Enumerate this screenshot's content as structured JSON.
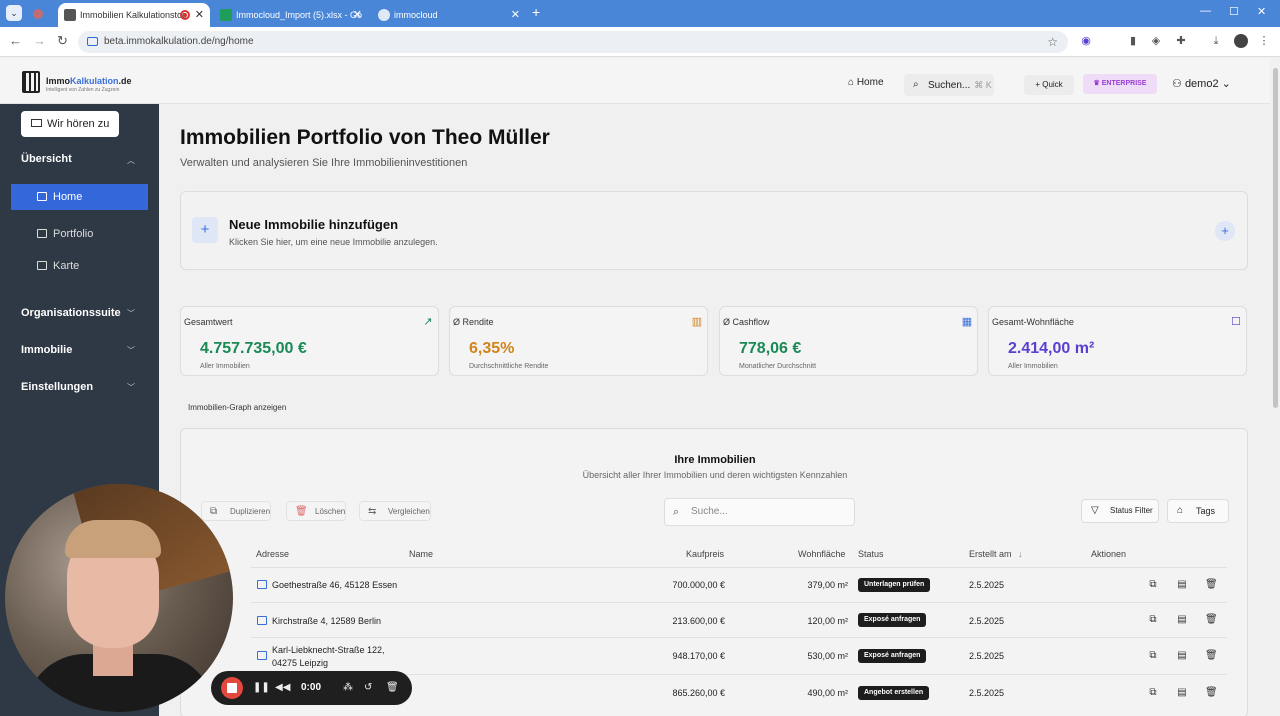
{
  "browser": {
    "tabs": [
      {
        "title": "Immobilien Kalkulationstoo",
        "active": true
      },
      {
        "title": "Immocloud_Import (5).xlsx - Go",
        "active": false
      },
      {
        "title": "immocloud",
        "active": false
      }
    ],
    "url": "beta.immokalkulation.de/ng/home"
  },
  "header": {
    "logo_prefix": "Immo",
    "logo_accent": "Kalkulation",
    "logo_suffix": ".de",
    "logo_tagline": "Intelligent von Zahlen zu Zugzein",
    "home": "Home",
    "search": "Suchen...",
    "search_kbd": "⌘ K",
    "quick": "Quick",
    "plan": "ENTERPRISE",
    "user": "demo2"
  },
  "sidebar": {
    "feedback": "Wir hören zu",
    "sections": {
      "uebersicht": "Übersicht",
      "organisationssuite": "Organisationssuite",
      "immobilie": "Immobilie",
      "einstellungen": "Einstellungen"
    },
    "items": {
      "home": "Home",
      "portfolio": "Portfolio",
      "karte": "Karte"
    }
  },
  "main": {
    "title": "Immobilien Portfolio von Theo Müller",
    "subtitle": "Verwalten und analysieren Sie Ihre Immobilieninvestitionen",
    "add_title": "Neue Immobilie hinzufügen",
    "add_sub": "Klicken Sie hier, um eine neue Immobilie anzulegen.",
    "graph_link": "Immobilien-Graph anzeigen",
    "stats": [
      {
        "label": "Gesamtwert",
        "value": "4.757.735,00 €",
        "sub": "Aller Immobilien",
        "color": "#1a8a55"
      },
      {
        "label": "Ø Rendite",
        "value": "6,35%",
        "sub": "Durchschnittliche Rendite",
        "color": "#d1841b"
      },
      {
        "label": "Ø Cashflow",
        "value": "778,06 €",
        "sub": "Monatlicher Durchschnitt",
        "color": "#1a8a55"
      },
      {
        "label": "Gesamt-Wohnfläche",
        "value": "2.414,00 m²",
        "sub": "Aller Immobilien",
        "color": "#5a3fd0"
      }
    ]
  },
  "table": {
    "title": "Ihre Immobilien",
    "subtitle": "Übersicht aller Ihrer Immobilien und deren wichtigsten Kennzahlen",
    "duplicate": "Duplizieren",
    "delete": "Löschen",
    "compare": "Vergleichen",
    "search_placeholder": "Suche...",
    "status_filter": "Status Filter",
    "tags": "Tags",
    "columns": {
      "address": "Adresse",
      "name": "Name",
      "price": "Kaufpreis",
      "area": "Wohnfläche",
      "status": "Status",
      "created": "Erstellt am",
      "created_sort": "↓",
      "actions": "Aktionen"
    },
    "rows": [
      {
        "address1": "Goethestraße 46, 45128 Essen",
        "address2": "",
        "price": "700.000,00 €",
        "area": "379,00 m²",
        "status": "Unterlagen prüfen",
        "created": "2.5.2025"
      },
      {
        "address1": "Kirchstraße 4, 12589 Berlin",
        "address2": "",
        "price": "213.600,00 €",
        "area": "120,00 m²",
        "status": "Exposé anfragen",
        "created": "2.5.2025"
      },
      {
        "address1": "Karl-Liebknecht-Straße 122,",
        "address2": "04275 Leipzig",
        "price": "948.170,00 €",
        "area": "530,00 m²",
        "status": "Exposé anfragen",
        "created": "2.5.2025"
      },
      {
        "address1": "",
        "address2": "",
        "price": "865.260,00 €",
        "area": "490,00 m²",
        "status": "Angebot erstellen",
        "created": "2.5.2025"
      }
    ]
  },
  "recorder": {
    "time": "0:00"
  }
}
